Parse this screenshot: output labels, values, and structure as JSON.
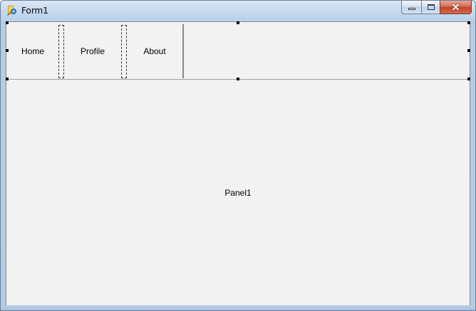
{
  "window": {
    "title": "Form1",
    "minimize_icon": "minimize-icon",
    "maximize_icon": "maximize-icon",
    "close_icon": "close-icon",
    "close_glyph": "✕",
    "app_icon": "delphi-app-icon"
  },
  "toolbar": {
    "buttons": [
      {
        "label": "Home"
      },
      {
        "label": "Profile"
      },
      {
        "label": "About"
      }
    ]
  },
  "main_panel": {
    "caption": "Panel1"
  },
  "colors": {
    "titlebar": "#c7daee",
    "client_bg": "#f2f2f2",
    "close_button": "#c2432b"
  }
}
